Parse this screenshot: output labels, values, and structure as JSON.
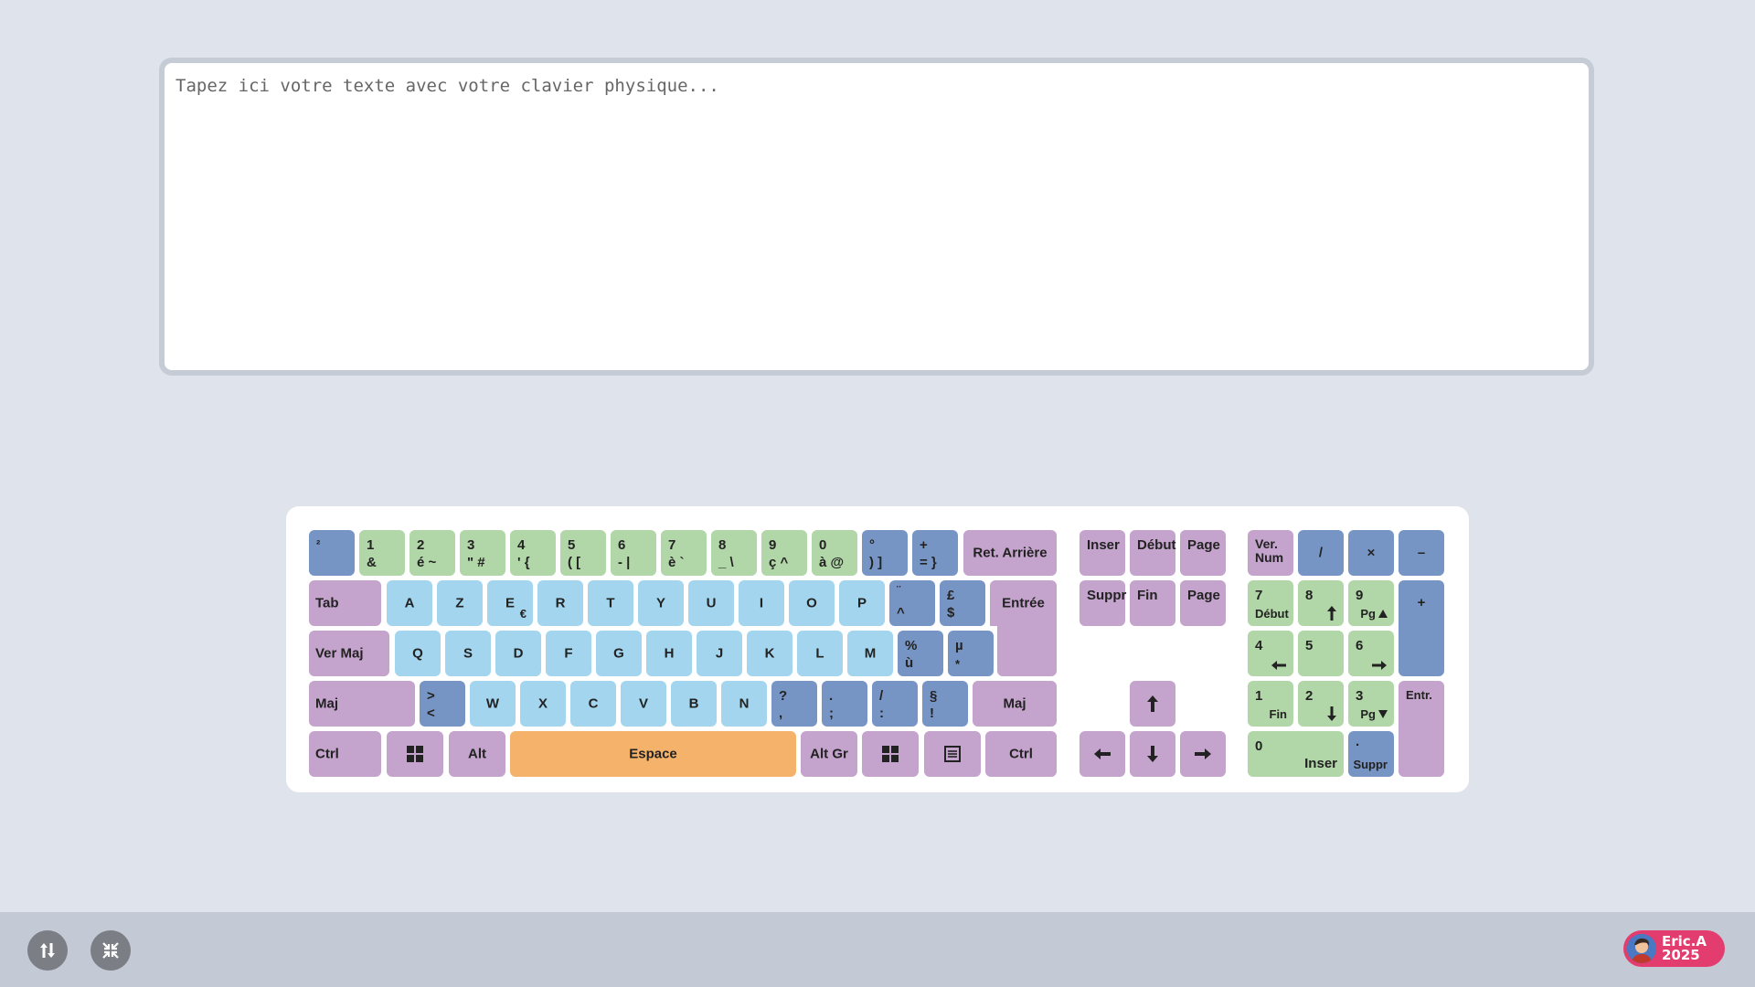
{
  "editor": {
    "placeholder": "Tapez ici votre texte avec votre clavier physique..."
  },
  "colors": {
    "purple": "#c4a3cc",
    "blue": "#7795c4",
    "green": "#b1d6a7",
    "light_blue": "#a3d6ee",
    "orange": "#f5b26b",
    "background": "#dfe3eb",
    "badge": "#e23d6e"
  },
  "keyboard": {
    "row1": {
      "sup2": "²",
      "k1_top": "1",
      "k1_bottom": "&",
      "k2_top": "2",
      "k2_bottom": "é ~",
      "k3_top": "3",
      "k3_bottom": "\" #",
      "k4_top": "4",
      "k4_bottom": "' {",
      "k5_top": "5",
      "k5_bottom": "( [",
      "k6_top": "6",
      "k6_bottom": "- |",
      "k7_top": "7",
      "k7_bottom": "è `",
      "k8_top": "8",
      "k8_bottom": "_ \\",
      "k9_top": "9",
      "k9_bottom": "ç ^",
      "k0_top": "0",
      "k0_bottom": "à @",
      "paren_top": "°",
      "paren_bottom": ") ]",
      "equal_top": "+",
      "equal_bottom": "= }",
      "backspace": "Ret. Arrière"
    },
    "row2": {
      "tab": "Tab",
      "a": "A",
      "z": "Z",
      "e": "E",
      "e_alt": "€",
      "r": "R",
      "t": "T",
      "y": "Y",
      "u": "U",
      "i": "I",
      "o": "O",
      "p": "P",
      "caret_top": "¨",
      "caret_bottom": "^",
      "dollar_top": "£",
      "dollar_bottom": "$",
      "enter": "Entrée"
    },
    "row3": {
      "caps": "Ver Maj",
      "q": "Q",
      "s": "S",
      "d": "D",
      "f": "F",
      "g": "G",
      "h": "H",
      "j": "J",
      "k": "K",
      "l": "L",
      "m": "M",
      "u_grave_top": "%",
      "u_grave_bottom": "ù",
      "mu_top": "µ",
      "mu_bottom": "*"
    },
    "row4": {
      "shift_left": "Maj",
      "angle_top": ">",
      "angle_bottom": "<",
      "w": "W",
      "x": "X",
      "c": "C",
      "v": "V",
      "b": "B",
      "n": "N",
      "comma_top": "?",
      "comma_bottom": ",",
      "semicolon_top": ".",
      "semicolon_bottom": ";",
      "colon_top": "/",
      "colon_bottom": ":",
      "excl_top": "§",
      "excl_bottom": "!",
      "shift_right": "Maj"
    },
    "row5": {
      "ctrl_left": "Ctrl",
      "alt": "Alt",
      "space": "Espace",
      "altgr": "Alt Gr",
      "ctrl_right": "Ctrl",
      "win_icon": "windows-icon",
      "menu_icon": "menu-icon"
    },
    "nav": {
      "insert": "Inser",
      "home": "Début",
      "page_up": "Page",
      "delete": "Suppr",
      "end": "Fin",
      "page_down": "Page"
    },
    "numpad": {
      "numlock": "Ver.\nNum",
      "divide": "/",
      "multiply": "×",
      "minus": "–",
      "plus": "+",
      "n7_top": "7",
      "n7_bottom": "Début",
      "n8_top": "8",
      "n9_top": "9",
      "n9_bottom": "Pg",
      "n4_top": "4",
      "n5_top": "5",
      "n6_top": "6",
      "n1_top": "1",
      "n1_bottom": "Fin",
      "n2_top": "2",
      "n3_top": "3",
      "n3_bottom": "Pg",
      "n0_top": "0",
      "n0_bottom": "Inser",
      "dot_top": ".",
      "dot_bottom": "Suppr",
      "enter": "Entr."
    }
  },
  "footer": {
    "badge_text": "Eric.A\n2025",
    "swap_icon": "swap-vertical-icon",
    "compress_icon": "compress-icon"
  }
}
